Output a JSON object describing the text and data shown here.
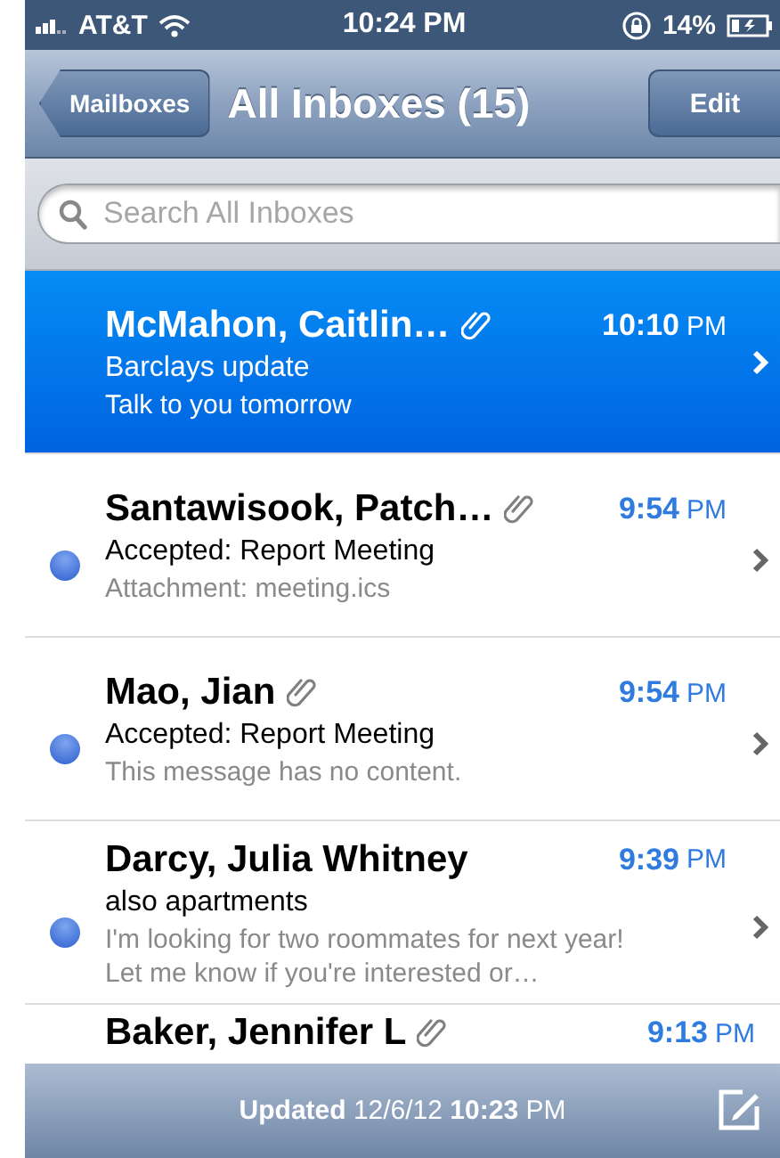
{
  "status_bar": {
    "carrier": "AT&T",
    "time": "10:24 PM",
    "battery": "14%"
  },
  "nav_bar": {
    "back": "Mailboxes",
    "title": "All Inboxes (15)",
    "action": "Edit"
  },
  "search": {
    "placeholder": "Search All Inboxes"
  },
  "messages": [
    {
      "sender": "McMahon, Caitlin…",
      "attachment": true,
      "time": "10:10",
      "ampm": "PM",
      "subject": "Barclays update",
      "preview": "Talk to you tomorrow",
      "unread": false,
      "selected": true
    },
    {
      "sender": "Santawisook, Patch…",
      "attachment": true,
      "time": "9:54",
      "ampm": "PM",
      "subject": "Accepted: Report Meeting",
      "preview": "Attachment: meeting.ics",
      "unread": true,
      "selected": false
    },
    {
      "sender": "Mao, Jian",
      "attachment": true,
      "time": "9:54",
      "ampm": "PM",
      "subject": "Accepted: Report Meeting",
      "preview": "This message has no content.",
      "unread": true,
      "selected": false
    },
    {
      "sender": "Darcy, Julia Whitney",
      "attachment": false,
      "time": "9:39",
      "ampm": "PM",
      "subject": "also apartments",
      "preview": "I'm looking for two roommates for next year! Let me know if you're interested or…",
      "unread": true,
      "selected": false
    },
    {
      "sender": "Baker, Jennifer L",
      "attachment": true,
      "time": "9:13",
      "ampm": "PM",
      "selected": false
    }
  ],
  "toolbar": {
    "status": "**Updated** 12/6/12 **10:23** PM"
  }
}
